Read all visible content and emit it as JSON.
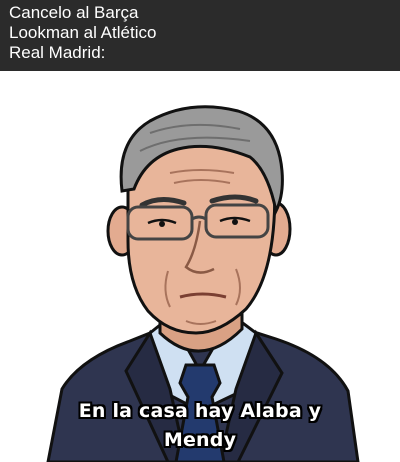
{
  "header": {
    "lines": [
      "Cancelo al Barça",
      "Lookman al Atlético",
      "Real Madrid:"
    ]
  },
  "meme": {
    "caption_line1": "En la casa hay Alaba y",
    "caption_line2": "Mendy",
    "illustration": "cartoon-portrait-of-older-man-in-suit-and-glasses",
    "colors": {
      "header_bg": "#2b2b2b",
      "suit": "#2f3550",
      "shirt": "#cfe0f2",
      "tie": "#233a6e",
      "skin": "#e8b59a",
      "hair": "#9a9a9a"
    }
  }
}
